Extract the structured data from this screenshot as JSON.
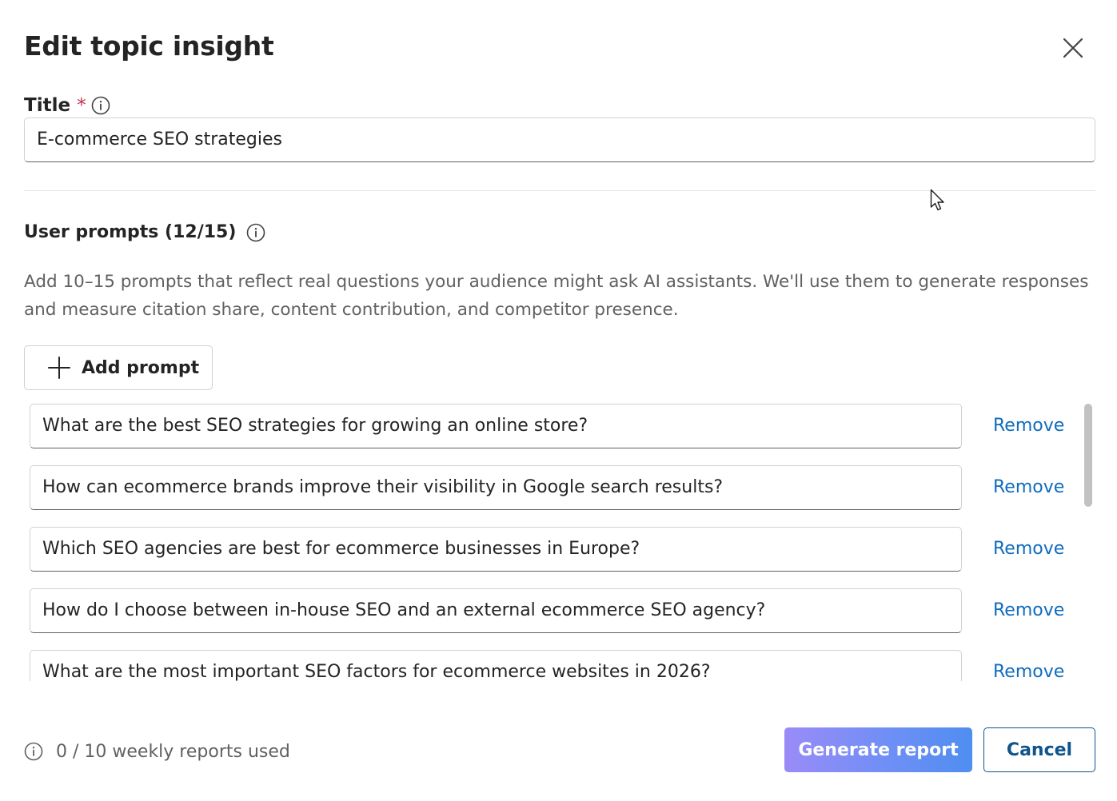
{
  "dialog": {
    "title": "Edit topic insight",
    "close_icon": "close-icon"
  },
  "title_field": {
    "label": "Title",
    "required_mark": "*",
    "value": "E-commerce SEO strategies"
  },
  "prompts_section": {
    "heading": "User prompts (12/15)",
    "description": "Add 10–15 prompts that reflect real questions your audience might ask AI assistants. We'll use them to generate responses and measure citation share, content contribution, and competitor presence.",
    "add_button_label": "Add prompt",
    "remove_label": "Remove",
    "items": [
      {
        "text": "What are the best SEO strategies for growing an online store?"
      },
      {
        "text": "How can ecommerce brands improve their visibility in Google search results?"
      },
      {
        "text": "Which SEO agencies are best for ecommerce businesses in Europe?"
      },
      {
        "text": "How do I choose between in-house SEO and an external ecommerce SEO agency?"
      },
      {
        "text": "What are the most important SEO factors for ecommerce websites in 2026?"
      }
    ]
  },
  "footer": {
    "usage_text": "0 / 10 weekly reports used",
    "generate_label": "Generate report",
    "cancel_label": "Cancel"
  },
  "colors": {
    "link": "#0f6cbd",
    "cancel_border": "#0f548c",
    "required": "#c4314b"
  }
}
